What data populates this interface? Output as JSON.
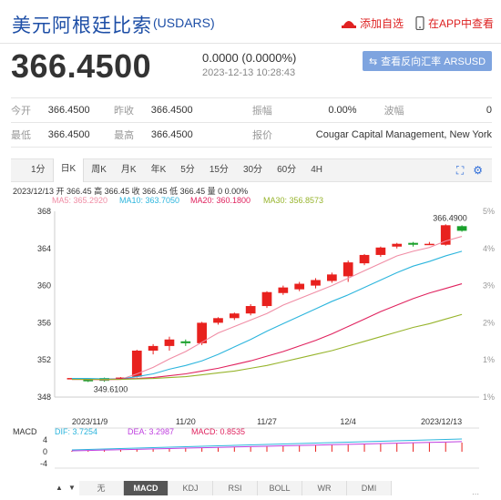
{
  "header": {
    "title": "美元阿根廷比索",
    "code": "(USDARS)",
    "add_watch": "添加自选",
    "view_app": "在APP中查看"
  },
  "quote": {
    "price": "366.4500",
    "change": "0.0000 (0.0000%)",
    "time": "2023-12-13 10:28:43",
    "calc_button": "查看反向汇率 ARSUSD"
  },
  "stats": [
    [
      {
        "label": "今开",
        "value": "366.4500"
      },
      {
        "label": "昨收",
        "value": "366.4500"
      },
      {
        "label": "振幅",
        "value": "0.00%"
      },
      {
        "label": "波幅",
        "value": "0"
      }
    ],
    [
      {
        "label": "最低",
        "value": "366.4500"
      },
      {
        "label": "最高",
        "value": "366.4500"
      },
      {
        "label": "报价",
        "value": "Cougar Capital Management, New York"
      }
    ]
  ],
  "tabs": [
    "1分",
    "日K",
    "周K",
    "月K",
    "年K",
    "5分",
    "15分",
    "30分",
    "60分",
    "4H"
  ],
  "active_tab": "日K",
  "info_line": "2023/12/13 开 366.45 高 366.45 收 366.45 低 366.45 量 0 0.00%",
  "ma": {
    "ma5": "MA5: 365.2920",
    "ma10": "MA10: 363.7050",
    "ma20": "MA20: 360.1800",
    "ma30": "MA30: 356.8573"
  },
  "colors": {
    "up": "#e8211e",
    "down": "#1aa12c",
    "ma5": "#f08da5",
    "ma10": "#2cb5dd",
    "ma20": "#e0225e",
    "ma30": "#97b42c",
    "brand": "#1d4ea6"
  },
  "chart_data": {
    "type": "candlestick",
    "y_ticks": [
      "368",
      "364",
      "360",
      "356",
      "352",
      "348"
    ],
    "pct_ticks": [
      "5%",
      "4%",
      "3%",
      "2%",
      "1%",
      "1%"
    ],
    "x_labels": [
      "2023/11/9",
      "11/20",
      "11/27",
      "12/4",
      "2023/12/13"
    ],
    "high_label": "366.4900",
    "low_label": "349.6100",
    "ylim": [
      348,
      368
    ],
    "candles": [
      [
        350.05,
        350.05,
        349.95,
        350.05
      ],
      [
        350.0,
        349.7,
        349.62,
        350.0
      ],
      [
        350.05,
        349.75,
        349.65,
        350.1
      ],
      [
        350.1,
        350.1,
        349.9,
        350.15
      ],
      [
        350.2,
        353.0,
        350.1,
        353.1
      ],
      [
        353.0,
        353.5,
        352.6,
        353.7
      ],
      [
        353.5,
        354.2,
        353.0,
        354.5
      ],
      [
        354.0,
        353.8,
        353.5,
        354.2
      ],
      [
        353.8,
        356.0,
        353.6,
        356.1
      ],
      [
        356.0,
        356.5,
        355.8,
        356.6
      ],
      [
        356.5,
        357.0,
        356.3,
        357.1
      ],
      [
        357.0,
        357.8,
        356.8,
        358.0
      ],
      [
        357.8,
        359.3,
        357.6,
        359.4
      ],
      [
        359.2,
        359.8,
        359.0,
        360.0
      ],
      [
        359.6,
        360.2,
        359.4,
        360.4
      ],
      [
        360.0,
        360.6,
        359.7,
        360.8
      ],
      [
        360.5,
        361.2,
        360.3,
        361.4
      ],
      [
        361.0,
        362.5,
        360.4,
        362.7
      ],
      [
        362.4,
        363.3,
        362.2,
        363.4
      ],
      [
        363.3,
        364.1,
        363.1,
        364.2
      ],
      [
        364.2,
        364.5,
        364.0,
        364.6
      ],
      [
        364.6,
        364.4,
        364.2,
        364.7
      ],
      [
        364.5,
        364.5,
        364.4,
        364.7
      ],
      [
        364.4,
        366.5,
        364.3,
        366.6
      ],
      [
        366.4,
        365.9,
        365.8,
        366.5
      ]
    ],
    "ma5": [
      350.0,
      349.9,
      349.85,
      349.9,
      350.5,
      351.2,
      352.1,
      352.9,
      353.9,
      354.9,
      355.6,
      356.3,
      357.0,
      357.9,
      358.6,
      359.3,
      360.0,
      360.8,
      361.6,
      362.4,
      363.2,
      363.7,
      364.1,
      364.8,
      365.3
    ],
    "ma10": [
      350.0,
      350.0,
      349.95,
      349.95,
      350.2,
      350.5,
      351.0,
      351.4,
      351.9,
      352.6,
      353.4,
      354.2,
      355.1,
      355.9,
      356.7,
      357.5,
      358.3,
      359.0,
      359.8,
      360.6,
      361.4,
      362.1,
      362.6,
      363.2,
      363.7
    ],
    "ma20": [
      349.9,
      349.9,
      349.9,
      349.95,
      350.0,
      350.1,
      350.3,
      350.5,
      350.8,
      351.1,
      351.5,
      351.9,
      352.4,
      352.9,
      353.5,
      354.1,
      354.8,
      355.6,
      356.4,
      357.2,
      357.9,
      358.6,
      359.2,
      359.7,
      360.2
    ],
    "ma30": [
      349.9,
      349.9,
      349.9,
      349.9,
      349.95,
      350.0,
      350.1,
      350.2,
      350.4,
      350.6,
      350.8,
      351.1,
      351.4,
      351.8,
      352.2,
      352.6,
      353.0,
      353.5,
      354.0,
      354.5,
      355.0,
      355.5,
      355.9,
      356.4,
      356.9
    ],
    "macd_label": "MACD",
    "dif": "DIF: 3.7254",
    "dea": "DEA: 3.2987",
    "macd": "MACD: 0.8535",
    "macd_ticks": [
      "4",
      "0",
      "-4"
    ]
  },
  "bottom_tabs": [
    "无",
    "MACD",
    "KDJ",
    "RSI",
    "BOLL",
    "WR",
    "DMI"
  ],
  "bottom_active": "MACD"
}
